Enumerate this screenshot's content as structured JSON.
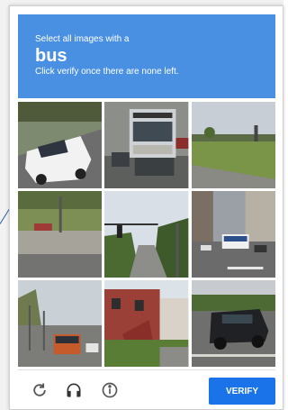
{
  "challenge": {
    "instruction": "Select all images with a",
    "target": "bus",
    "subtext": "Click verify once there are none left."
  },
  "tiles": [
    {
      "name": "tile-1",
      "content": "white-van"
    },
    {
      "name": "tile-2",
      "content": "bus-front"
    },
    {
      "name": "tile-3",
      "content": "grass-road"
    },
    {
      "name": "tile-4",
      "content": "highway-barrier"
    },
    {
      "name": "tile-5",
      "content": "traffic-light"
    },
    {
      "name": "tile-6",
      "content": "city-bus"
    },
    {
      "name": "tile-7",
      "content": "bus-station"
    },
    {
      "name": "tile-8",
      "content": "brick-house"
    },
    {
      "name": "tile-9",
      "content": "black-suv"
    }
  ],
  "footer": {
    "reload_icon": "reload-icon",
    "audio_icon": "headphones-icon",
    "info_icon": "info-icon",
    "verify_label": "VERIFY"
  },
  "colors": {
    "header": "#4a90e2",
    "verify_button": "#1a73e8"
  }
}
